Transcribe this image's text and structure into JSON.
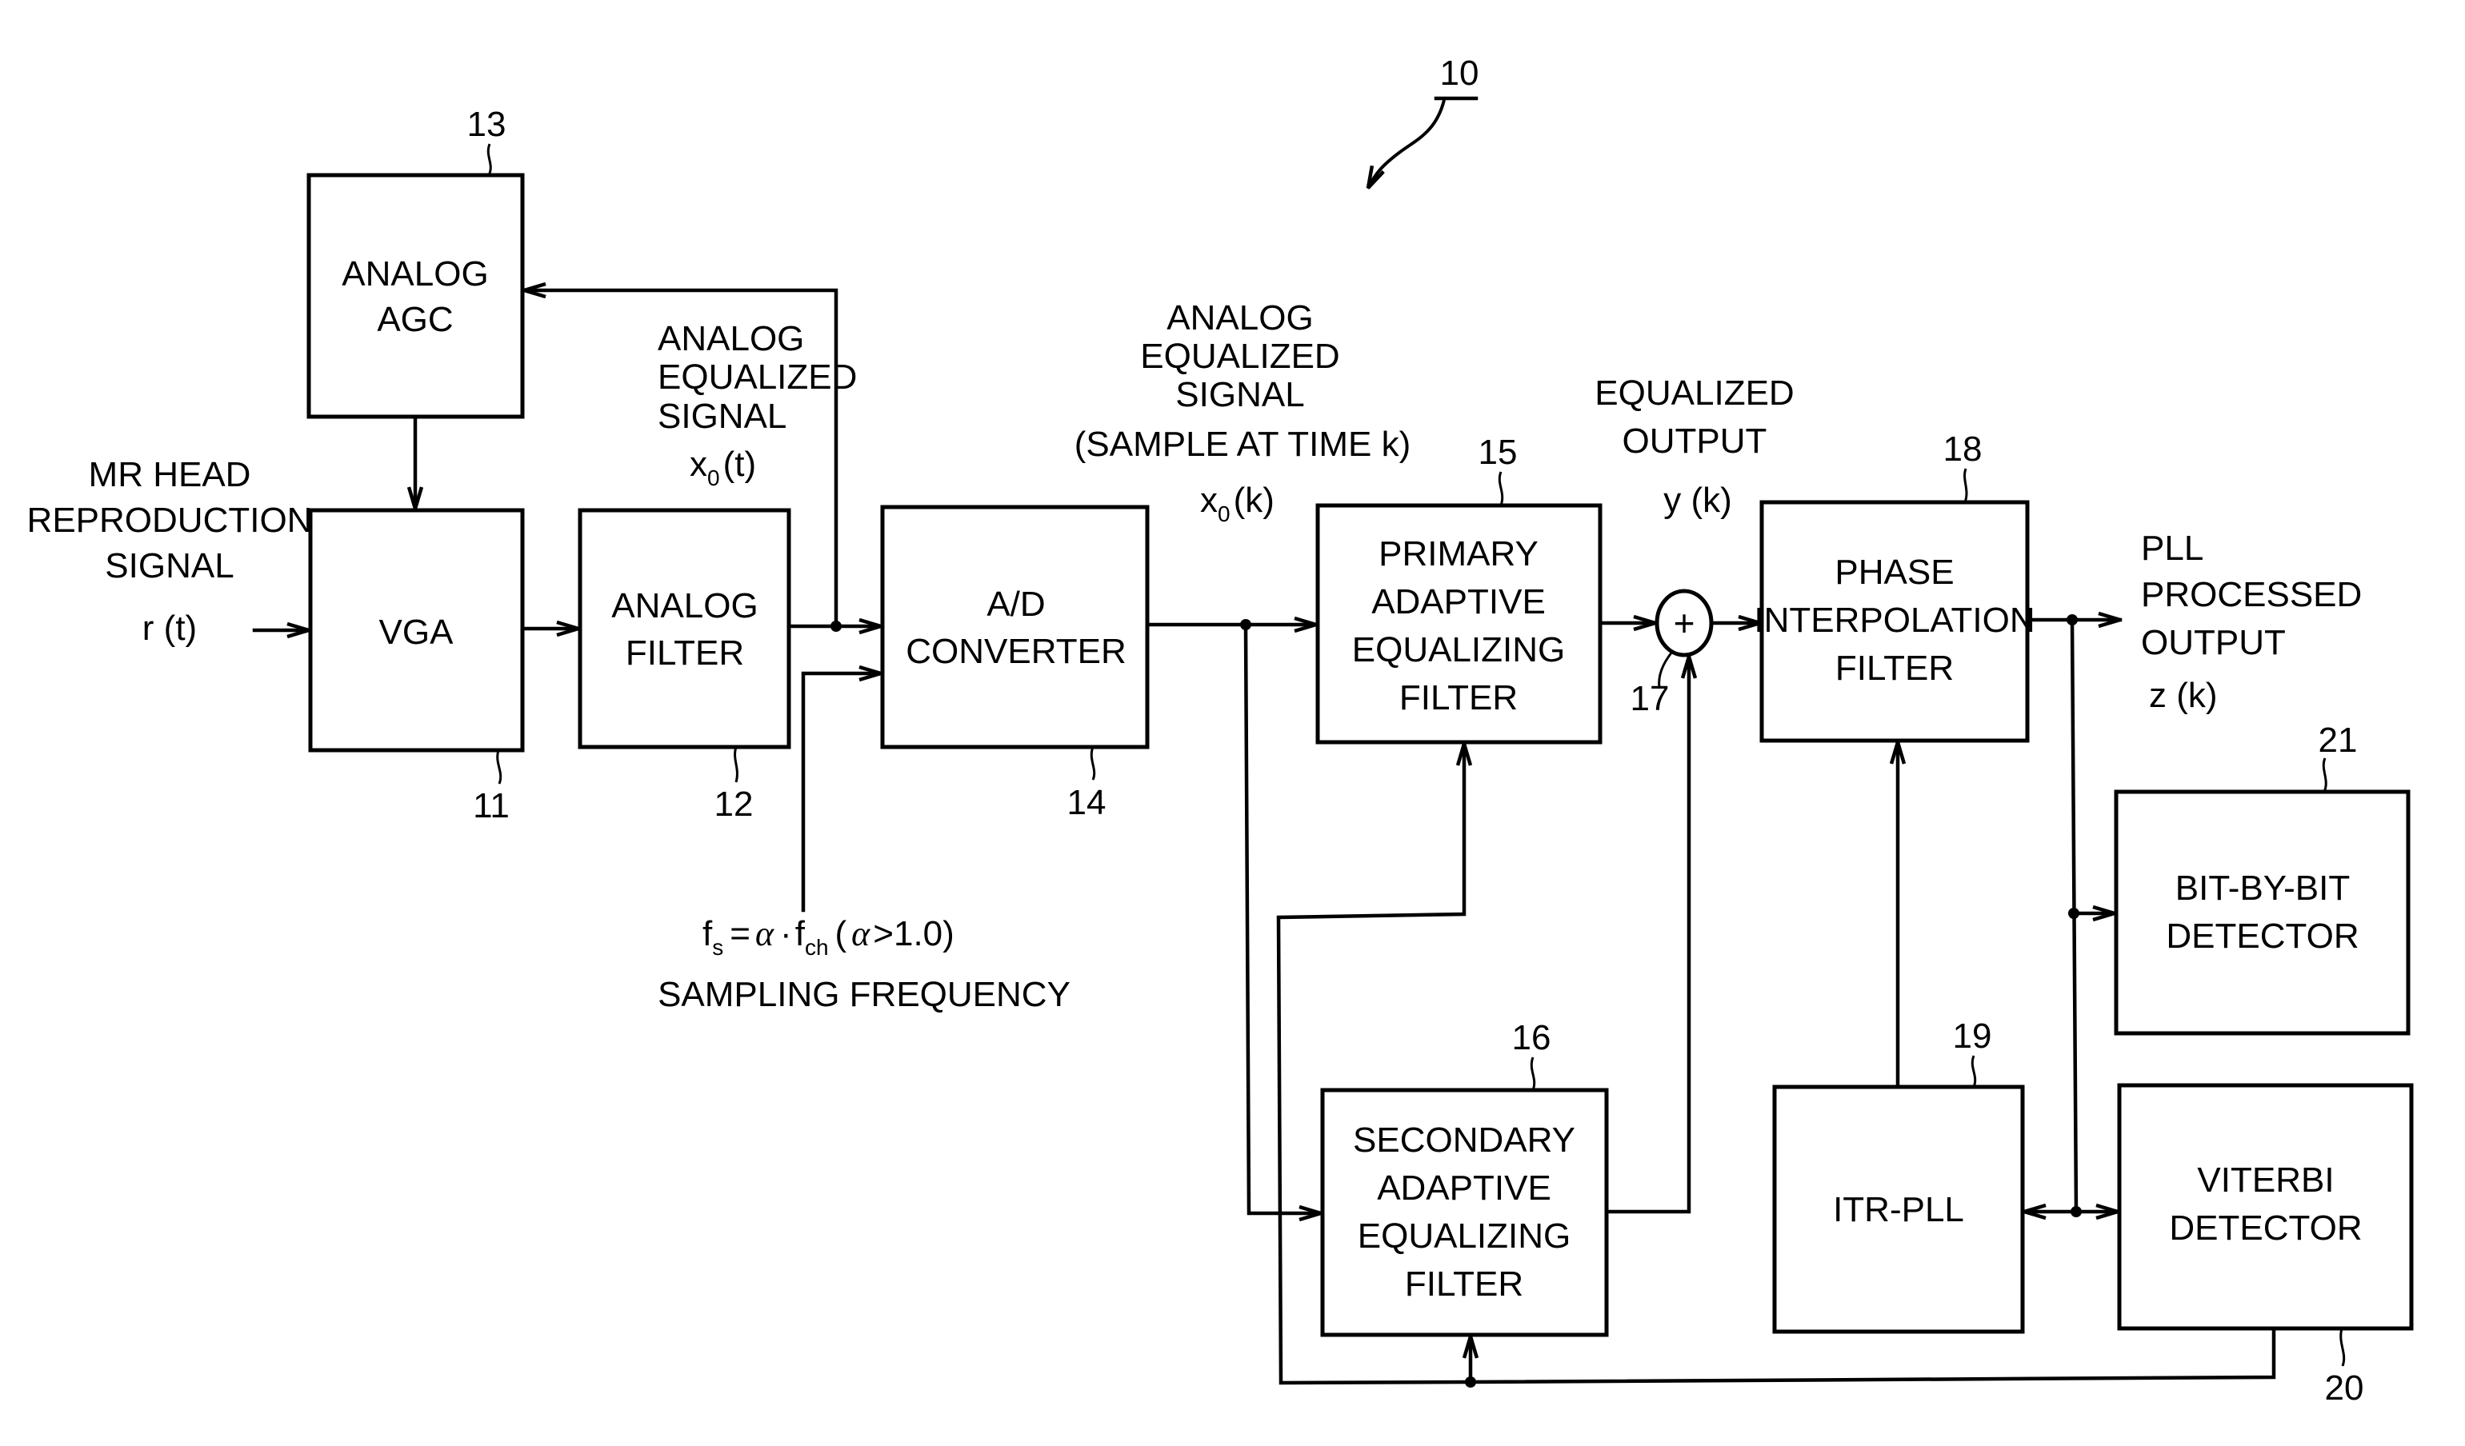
{
  "figure": {
    "reference_number": "10",
    "blocks": [
      {
        "id": "vga",
        "ref": "11",
        "lines": [
          "VGA"
        ]
      },
      {
        "id": "analog-filter",
        "ref": "12",
        "lines": [
          "ANALOG",
          "FILTER"
        ]
      },
      {
        "id": "analog-agc",
        "ref": "13",
        "lines": [
          "ANALOG",
          "AGC"
        ]
      },
      {
        "id": "ad-converter",
        "ref": "14",
        "lines": [
          "A/D",
          "CONVERTER"
        ]
      },
      {
        "id": "primary-adaptive-equalizing-filter",
        "ref": "15",
        "lines": [
          "PRIMARY",
          "ADAPTIVE",
          "EQUALIZING",
          "FILTER"
        ]
      },
      {
        "id": "secondary-adaptive-equalizing-filter",
        "ref": "16",
        "lines": [
          "SECONDARY",
          "ADAPTIVE",
          "EQUALIZING",
          "FILTER"
        ]
      },
      {
        "id": "adder",
        "ref": "17",
        "symbol": "+"
      },
      {
        "id": "phase-interpolation-filter",
        "ref": "18",
        "lines": [
          "PHASE",
          "INTERPOLATION",
          "FILTER"
        ]
      },
      {
        "id": "itr-pll",
        "ref": "19",
        "lines": [
          "ITR-PLL"
        ]
      },
      {
        "id": "viterbi-detector",
        "ref": "20",
        "lines": [
          "VITERBI",
          "DETECTOR"
        ]
      },
      {
        "id": "bit-by-bit-detector",
        "ref": "21",
        "lines": [
          "BIT-BY-BIT",
          "DETECTOR"
        ]
      }
    ],
    "labels": {
      "input": {
        "lines": [
          "MR HEAD",
          "REPRODUCTION",
          "SIGNAL"
        ],
        "symbol": "r (t)"
      },
      "analog_equalized": {
        "lines": [
          "ANALOG",
          "EQUALIZED",
          "SIGNAL"
        ],
        "symbol_base": "x",
        "symbol_sub": "0",
        "symbol_arg": "(t)"
      },
      "sampled": {
        "lines": [
          "ANALOG",
          "EQUALIZED",
          "SIGNAL",
          "(SAMPLE AT TIME k)"
        ],
        "symbol_base": "x",
        "symbol_sub": "0",
        "symbol_arg": "(k)"
      },
      "equalized_output": {
        "lines": [
          "EQUALIZED",
          "OUTPUT"
        ],
        "symbol": "y (k)"
      },
      "pll_output": {
        "lines": [
          "PLL",
          "PROCESSED",
          "OUTPUT"
        ],
        "symbol": "z (k)"
      },
      "sampling": {
        "f": "f",
        "f_sub": "s",
        "eq": "=",
        "alpha": "α",
        "dot": "·",
        "f2": "f",
        "f2_sub": "ch",
        "cond_open": "(",
        "cond_alpha": "α",
        "cond_rest": ">1.0)",
        "caption": "SAMPLING FREQUENCY"
      }
    }
  }
}
